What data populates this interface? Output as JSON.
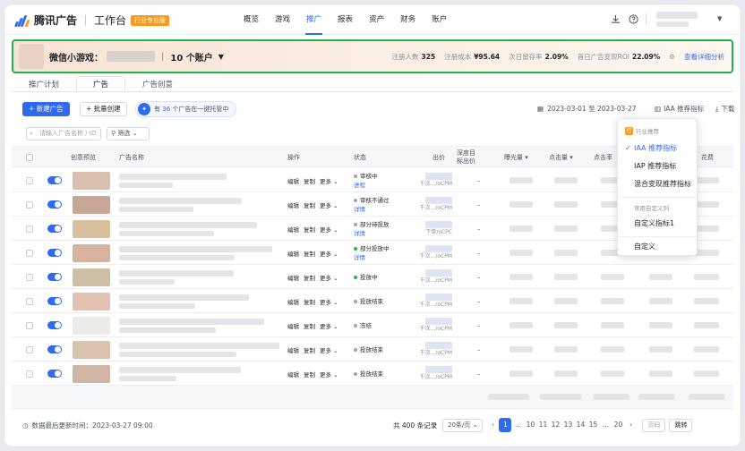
{
  "brand": {
    "name": "腾讯广告",
    "sub": "工作台",
    "badge": "行业专业版"
  },
  "nav": [
    "概览",
    "游戏",
    "推广",
    "报表",
    "资产",
    "财务",
    "账户"
  ],
  "nav_active": 2,
  "banner": {
    "label": "微信小游戏：",
    "sep": "|",
    "count": "10 个账户",
    "metrics": [
      {
        "label": "注册人数",
        "value": "325"
      },
      {
        "label": "注册成本",
        "value": "¥95.64"
      },
      {
        "label": "次日留存率",
        "value": "2.09%"
      },
      {
        "label": "首日广告变现ROI",
        "value": "22.09%"
      }
    ],
    "link": "查看详细分析"
  },
  "tabs": [
    "推广计划",
    "广告",
    "广告创意"
  ],
  "tab_active": 1,
  "toolbar": {
    "new_ad": "+ 新建广告",
    "batch": "+ 批量创建",
    "promo_pre": "有",
    "promo_num": "36",
    "promo_post": "个广告在一键托管中",
    "date": "2023-03-01 至 2023-03-27",
    "metric_set": "IAA 推荐指标",
    "download": "下载"
  },
  "search": {
    "placeholder": "请输入广告名称 / ID"
  },
  "filter": {
    "label": "筛选"
  },
  "table": {
    "headers": {
      "preview": "创意预览",
      "name": "广告名称",
      "op": "操作",
      "status": "状态",
      "bid": "出价",
      "deep1": "深度目",
      "deep2": "标出价",
      "exposure": "曝光量",
      "clicks": "点击量",
      "ctr": "点击率",
      "spend": "花费"
    },
    "ops": [
      "编辑",
      "复制",
      "更多"
    ],
    "rows": [
      {
        "status": "审核中",
        "sub": "进程",
        "dot": "#a0a4ad",
        "bid": "千次.../oCPM",
        "thumb": "#d9bfae"
      },
      {
        "status": "审核不通过",
        "sub": "详情",
        "dot": "#a0a4ad",
        "bid": "千次.../oCPM",
        "thumb": "#c8a797"
      },
      {
        "status": "部分待投放",
        "sub": "详情",
        "dot": "#a0a4ad",
        "bid": "下单/oCPC",
        "thumb": "#d8c19e"
      },
      {
        "status": "部分投放中",
        "sub": "详情",
        "dot": "#2bb34f",
        "bid": "千次.../oCPM",
        "thumb": "#d6b39e"
      },
      {
        "status": "投放中",
        "sub": "",
        "dot": "#2bb34f",
        "bid": "千次.../oCPM",
        "thumb": "#cdbfa6"
      },
      {
        "status": "投放结束",
        "sub": "",
        "dot": "#a0a4ad",
        "bid": "千次.../oCPM",
        "thumb": "#e1c2b2"
      },
      {
        "status": "冻结",
        "sub": "",
        "dot": "#a0a4ad",
        "bid": "千次.../oCPM",
        "thumb": "#eeece9"
      },
      {
        "status": "投放结束",
        "sub": "",
        "dot": "#a0a4ad",
        "bid": "千次.../oCPM",
        "thumb": "#d9c2ae"
      },
      {
        "status": "投放结束",
        "sub": "",
        "dot": "#a0a4ad",
        "bid": "千次.../oCPM",
        "thumb": "#cfb5a4"
      }
    ],
    "dash": "–"
  },
  "footer": {
    "updated": "数据最后更新时间：2023-03-27 09:00",
    "total": "共 400 条记录",
    "page_size": "20条/页",
    "pages": [
      "1",
      "...",
      "10",
      "11",
      "12",
      "13",
      "14",
      "15",
      "...",
      "20"
    ],
    "page_placeholder": "页码",
    "jump": "跳转"
  },
  "dropdown": {
    "group1": "行业推荐",
    "group1_tag": "行",
    "items1": [
      "IAA 推荐指标",
      "IAP 推荐指标",
      "混合变现推荐指标"
    ],
    "group2": "常用自定义列",
    "items2": [
      "自定义指标1"
    ],
    "custom": "自定义"
  },
  "colors": {
    "primary": "#2f6bf0",
    "highlight_border": "#1bb54a",
    "badge": "#f59a23"
  }
}
